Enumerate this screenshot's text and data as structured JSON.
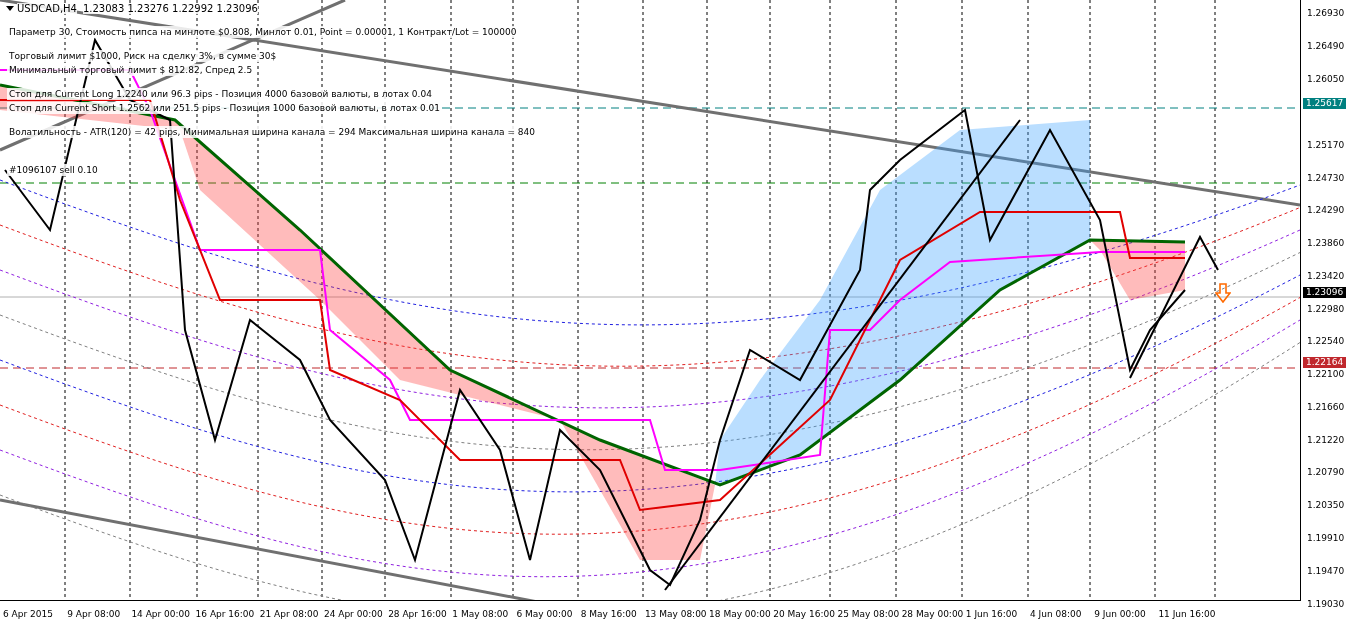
{
  "chart_header": {
    "symbol": "USDCAD,H4",
    "quotes": "1.23083 1.23276 1.22992 1.23096"
  },
  "info_groups": [
    {
      "lines": [
        "Параметр 30,  Стоимость пипса на минлоте  $0.808,   Минлот  0.01,  Point = 0.00001,  1 Контракт/Lot = 100000"
      ]
    },
    {
      "lines": [
        "Торговый лимит  $1000,  Риск на сделку 3%,  в сумме 30$",
        "Минимальный торговый лимит  $ 812.82,   Спред  2.5"
      ]
    },
    {
      "lines": [
        "Стоп для Current Long 1.2240 или  96.3 pips -  Позиция 4000 базовой валюты,  в лотах 0.04",
        "Стоп для Current Short 1.2562 или  251.5 pips -  Позиция 1000 базовой валюты,  в лотах 0.01"
      ]
    },
    {
      "lines": [
        "Волатильность - ATR(120) = 42 pips,  Минимальная ширина канала = 294    Максимальная ширина канала = 840"
      ]
    }
  ],
  "order_label": "#1096107 sell 0.10",
  "price_axis": {
    "labels": [
      "1.26930",
      "1.26490",
      "1.26050",
      "1.25170",
      "1.24730",
      "1.24290",
      "1.23860",
      "1.23420",
      "1.22980",
      "1.22540",
      "1.22100",
      "1.21660",
      "1.21220",
      "1.20790",
      "1.20350",
      "1.19910",
      "1.19470",
      "1.19030"
    ],
    "markers": [
      {
        "price": "1.25617",
        "color": "#008080"
      },
      {
        "price": "1.23096",
        "color": "#000000"
      },
      {
        "price": "1.22164",
        "color": "#c0282d"
      }
    ]
  },
  "time_axis": [
    "6 Apr 2015",
    "9 Apr 08:00",
    "14 Apr 00:00",
    "16 Apr 16:00",
    "21 Apr 08:00",
    "24 Apr 00:00",
    "28 Apr 16:00",
    "1 May 08:00",
    "6 May 00:00",
    "8 May 16:00",
    "13 May 08:00",
    "18 May 00:00",
    "20 May 16:00",
    "25 May 08:00",
    "28 May 00:00",
    "1 Jun 16:00",
    "4 Jun 08:00",
    "9 Jun 00:00",
    "11 Jun 16:00"
  ]
}
